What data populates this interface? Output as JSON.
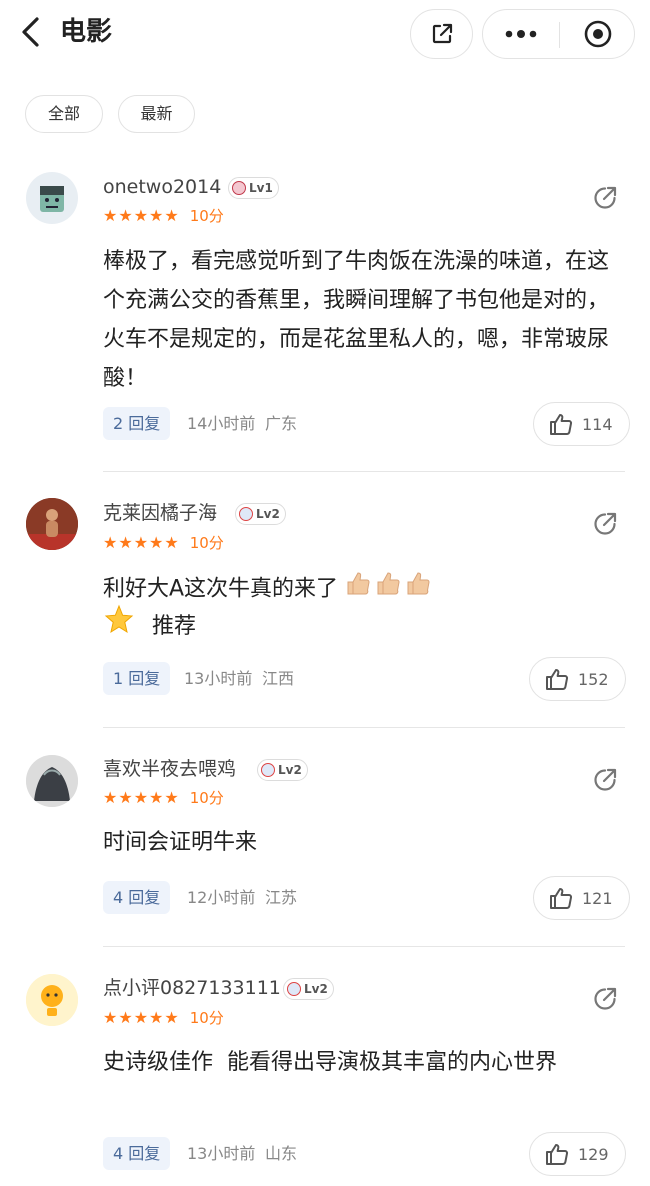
{
  "header": {
    "title": "电影"
  },
  "filters": [
    "全部",
    "最新"
  ],
  "comments": [
    {
      "username": "onetwo2014",
      "level": "Lv1",
      "stars": "★★★★★",
      "score": "10分",
      "text": "棒极了，看完感觉听到了牛肉饭在洗澡的味道，在这个充满公交的香蕉里，我瞬间理解了书包他是对的，火车不是规定的，而是花盆里私人的，嗯，非常玻尿酸！",
      "replies": "2 回复",
      "time": "14小时前",
      "location": "广东",
      "likes": "114"
    },
    {
      "username": "克莱因橘子海",
      "level": "Lv2",
      "stars": "★★★★★",
      "score": "10分",
      "text": "利好大A这次牛真的来了",
      "text2": "推荐",
      "replies": "1 回复",
      "time": "13小时前",
      "location": "江西",
      "likes": "152"
    },
    {
      "username": "喜欢半夜去喂鸡",
      "level": "Lv2",
      "stars": "★★★★★",
      "score": "10分",
      "text": "时间会证明牛来",
      "replies": "4 回复",
      "time": "12小时前",
      "location": "江苏",
      "likes": "121"
    },
    {
      "username": "点小评0827133111",
      "level": "Lv2",
      "stars": "★★★★★",
      "score": "10分",
      "text": "史诗级佳作  能看得出导演极其丰富的内心世界",
      "replies": "4 回复",
      "time": "13小时前",
      "location": "山东",
      "likes": "129"
    }
  ],
  "colors": {
    "star": "#ff7a1a",
    "reply_bg": "#eef3fb",
    "reply_text": "#4a6a9a"
  },
  "icons": [
    "back-arrow-icon",
    "share-out-icon",
    "more-dots-icon",
    "close-target-icon",
    "share-icon",
    "thumbs-up-icon",
    "level-badge-icon",
    "thumbs-up-emoji",
    "star-emoji"
  ]
}
